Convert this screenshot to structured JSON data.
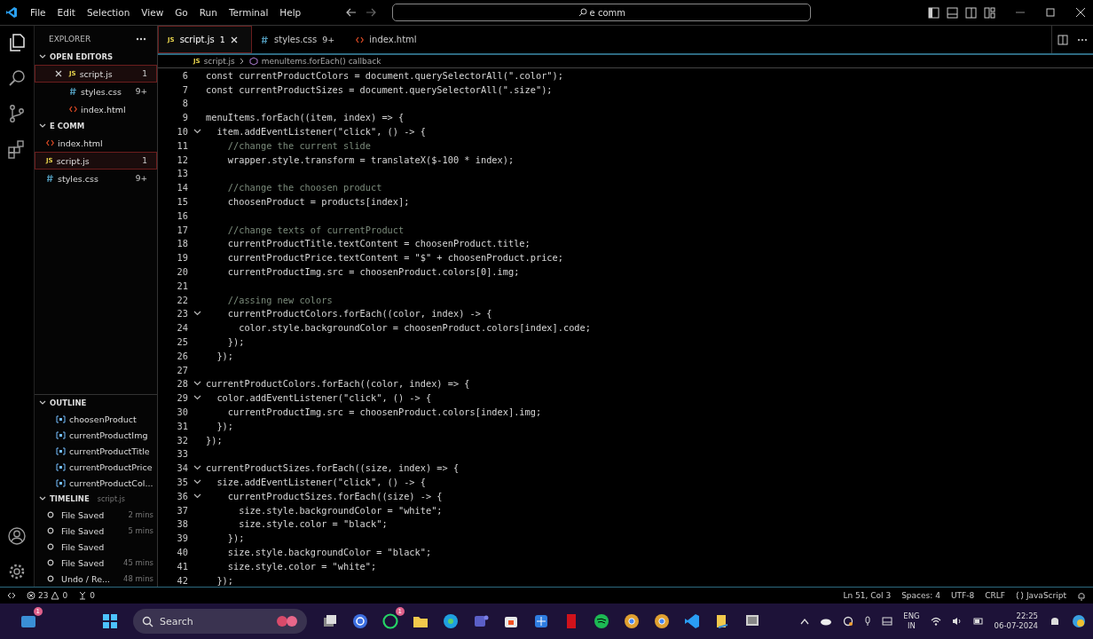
{
  "menu": [
    "File",
    "Edit",
    "Selection",
    "View",
    "Go",
    "Run",
    "Terminal",
    "Help"
  ],
  "command_center": {
    "value": "e comm"
  },
  "sidebar": {
    "title": "EXPLORER",
    "open_editors": {
      "title": "OPEN EDITORS",
      "expanded": true,
      "items": [
        {
          "name": "script.js",
          "kind": "js",
          "icon_label": "JS",
          "badge": "1",
          "selected": true,
          "close": true
        },
        {
          "name": "styles.css",
          "kind": "css",
          "badge": "9+",
          "selected": false,
          "close": false
        },
        {
          "name": "index.html",
          "kind": "html",
          "selected": false,
          "close": false
        }
      ]
    },
    "folder": {
      "title": "E COMM",
      "expanded": true,
      "items": [
        {
          "name": "index.html",
          "kind": "html",
          "selected": false
        },
        {
          "name": "script.js",
          "kind": "js",
          "icon_label": "JS",
          "badge": "1",
          "selected": true
        },
        {
          "name": "styles.css",
          "kind": "css",
          "badge": "9+",
          "selected": false
        }
      ]
    },
    "outline": {
      "title": "OUTLINE",
      "expanded": true,
      "items": [
        "choosenProduct",
        "currentProductImg",
        "currentProductTitle",
        "currentProductPrice",
        "currentProductCol..."
      ]
    },
    "timeline": {
      "title": "TIMELINE",
      "file": "script.js",
      "expanded": true,
      "items": [
        {
          "label": "File Saved",
          "time": "2 mins"
        },
        {
          "label": "File Saved",
          "time": "5 mins"
        },
        {
          "label": "File Saved"
        },
        {
          "label": "File Saved",
          "time": "45 mins"
        },
        {
          "label": "Undo / Re...",
          "time": "48 mins"
        }
      ]
    }
  },
  "tabs": [
    {
      "name": "script.js",
      "kind": "js",
      "icon_label": "JS",
      "badge": "1",
      "selected": true
    },
    {
      "name": "styles.css",
      "kind": "css",
      "badge": "9+",
      "selected": false
    },
    {
      "name": "index.html",
      "kind": "html",
      "selected": false
    }
  ],
  "breadcrumb": [
    {
      "kind": "file",
      "icon_label": "JS",
      "label": "script.js"
    },
    {
      "kind": "method",
      "label": "menuItems.forEach() callback"
    }
  ],
  "code": [
    {
      "n": "6",
      "text": "const currentProductColors = document.querySelectorAll(\".color\");",
      "kind": "code",
      "fold": false
    },
    {
      "n": "7",
      "text": "const currentProductSizes = document.querySelectorAll(\".size\");",
      "kind": "code",
      "fold": false
    },
    {
      "n": "8",
      "fold": false
    },
    {
      "n": "9",
      "text": "menuItems.forEach((item, index) => {",
      "kind": "code",
      "fold": false
    },
    {
      "n": "10",
      "text": "  item.addEventListener(\"click\", () -> {",
      "kind": "code",
      "fold": true
    },
    {
      "n": "11",
      "text": "    //change the current slide",
      "kind": "comment",
      "fold": false
    },
    {
      "n": "12",
      "text": "    wrapper.style.transform = translateX($-100 * index);",
      "kind": "code",
      "fold": false
    },
    {
      "n": "13",
      "fold": false
    },
    {
      "n": "14",
      "text": "    //change the choosen product",
      "kind": "comment",
      "fold": false
    },
    {
      "n": "15",
      "text": "    choosenProduct = products[index];",
      "kind": "code",
      "fold": false
    },
    {
      "n": "16",
      "fold": false
    },
    {
      "n": "17",
      "text": "    //change texts of currentProduct",
      "kind": "comment",
      "fold": false
    },
    {
      "n": "18",
      "text": "    currentProductTitle.textContent = choosenProduct.title;",
      "kind": "code",
      "fold": false
    },
    {
      "n": "19",
      "text": "    currentProductPrice.textContent = \"$\" + choosenProduct.price;",
      "kind": "code",
      "fold": false
    },
    {
      "n": "20",
      "text": "    currentProductImg.src = choosenProduct.colors[0].img;",
      "kind": "code",
      "fold": false
    },
    {
      "n": "21",
      "fold": false
    },
    {
      "n": "22",
      "text": "    //assing new colors",
      "kind": "comment",
      "fold": false
    },
    {
      "n": "23",
      "text": "    currentProductColors.forEach((color, index) -> {",
      "kind": "code",
      "fold": true
    },
    {
      "n": "24",
      "text": "      color.style.backgroundColor = choosenProduct.colors[index].code;",
      "kind": "code",
      "fold": false
    },
    {
      "n": "25",
      "text": "    });",
      "kind": "code",
      "fold": false
    },
    {
      "n": "26",
      "text": "  });",
      "kind": "code",
      "fold": false
    },
    {
      "n": "27",
      "fold": false
    },
    {
      "n": "28",
      "text": "currentProductColors.forEach((color, index) => {",
      "kind": "code",
      "fold": true
    },
    {
      "n": "29",
      "text": "  color.addEventListener(\"click\", () -> {",
      "kind": "code",
      "fold": true
    },
    {
      "n": "30",
      "text": "    currentProductImg.src = choosenProduct.colors[index].img;",
      "kind": "code",
      "fold": false
    },
    {
      "n": "31",
      "text": "  });",
      "kind": "code",
      "fold": false
    },
    {
      "n": "32",
      "text": "});",
      "kind": "code",
      "fold": false
    },
    {
      "n": "33",
      "fold": false
    },
    {
      "n": "34",
      "text": "currentProductSizes.forEach((size, index) => {",
      "kind": "code",
      "fold": true
    },
    {
      "n": "35",
      "text": "  size.addEventListener(\"click\", () -> {",
      "kind": "code",
      "fold": true
    },
    {
      "n": "36",
      "text": "    currentProductSizes.forEach((size) -> {",
      "kind": "code",
      "fold": true
    },
    {
      "n": "37",
      "text": "      size.style.backgroundColor = \"white\";",
      "kind": "code",
      "fold": false
    },
    {
      "n": "38",
      "text": "      size.style.color = \"black\";",
      "kind": "code",
      "fold": false
    },
    {
      "n": "39",
      "text": "    });",
      "kind": "code",
      "fold": false
    },
    {
      "n": "40",
      "text": "    size.style.backgroundColor = \"black\";",
      "kind": "code",
      "fold": false
    },
    {
      "n": "41",
      "text": "    size.style.color = \"white\";",
      "kind": "code",
      "fold": false
    },
    {
      "n": "42",
      "text": "  });",
      "kind": "code",
      "fold": false
    }
  ],
  "status_bar": {
    "errors": "23",
    "warnings": "0",
    "ports": "0",
    "items": [
      "Ln 51, Col 3",
      "Spaces: 4",
      "UTF-8",
      "CRLF"
    ],
    "language": "JavaScript"
  },
  "taskbar": {
    "search": {
      "placeholder": "Search"
    },
    "apps": [
      {
        "kind": "widgets",
        "badge": "1"
      },
      {
        "kind": "start"
      },
      {
        "kind": "taskview"
      },
      {
        "kind": "sync"
      },
      {
        "kind": "chat",
        "badge": "1"
      },
      {
        "kind": "folder"
      },
      {
        "kind": "edge"
      },
      {
        "kind": "teams"
      },
      {
        "kind": "store"
      },
      {
        "kind": "grid"
      },
      {
        "kind": "video"
      },
      {
        "kind": "music"
      },
      {
        "kind": "chrome"
      },
      {
        "kind": "chrome"
      },
      {
        "kind": "editor"
      },
      {
        "kind": "notes"
      },
      {
        "kind": "snip"
      }
    ],
    "language": [
      "ENG",
      "IN"
    ],
    "time": "22:25",
    "date": "06-07-2024"
  }
}
